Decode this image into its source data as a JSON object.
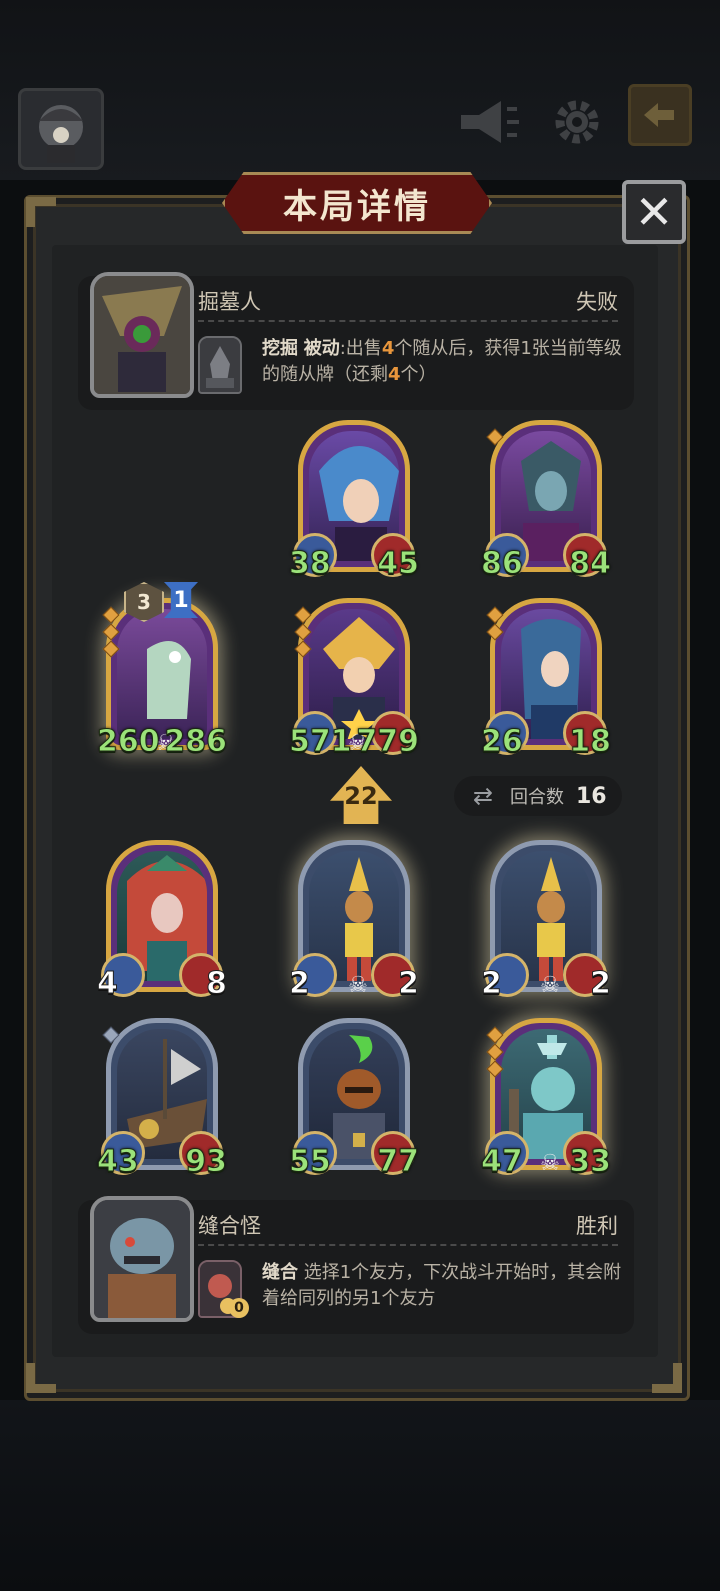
{
  "header": {
    "avatar_icon": "player-avatar-icon",
    "announcement_icon": "megaphone-icon",
    "settings_icon": "gear-icon",
    "exit_icon": "exit-door-icon"
  },
  "panel": {
    "title": "本局详情",
    "close_icon": "close-icon",
    "close_glyph": "✕"
  },
  "opponent": {
    "name": "掘墓人",
    "result": "失败",
    "ability_name": "挖掘",
    "ability_type": "被动",
    "ability_text_1": ":出售",
    "ability_num_1": "4",
    "ability_text_2": "个随从后，获得1张当前等级的随从牌（还剩",
    "ability_num_2": "4",
    "ability_text_3": "个）"
  },
  "opponent_board": {
    "minions": [
      {
        "attack": "38",
        "health": "45",
        "frame": "gold",
        "art_color": "#5a3f95",
        "pips": 0
      },
      {
        "attack": "86",
        "health": "84",
        "frame": "gold",
        "art_color": "#6a3a8a",
        "pips": 1
      },
      {
        "attack": "260",
        "health": "286",
        "frame": "gold",
        "art_color": "#6b3b86",
        "pips": 3,
        "tier": "3",
        "level": "1",
        "deathrattle": true,
        "glow": true
      },
      {
        "attack": "571",
        "health": "779",
        "frame": "gold",
        "art_color": "#55357a",
        "pips": 3,
        "deathrattle": true
      },
      {
        "attack": "26",
        "health": "18",
        "frame": "gold",
        "art_color": "#5a3c88",
        "pips": 2
      }
    ]
  },
  "mid": {
    "tavern_tier": "22",
    "turn_label": "回合数",
    "turn_number": "16",
    "turn_icon": "swap-arrows-icon"
  },
  "player_board": {
    "minions": [
      {
        "attack": "4",
        "health": "8",
        "frame": "gold",
        "art_color": "#2d5a58",
        "pips": 0,
        "white_stats": true
      },
      {
        "attack": "2",
        "health": "2",
        "frame": "silver",
        "art_color": "#3c4f6e",
        "pips": 0,
        "white_stats": true,
        "deathrattle": true,
        "glow": true
      },
      {
        "attack": "2",
        "health": "2",
        "frame": "silver",
        "art_color": "#3c4f6e",
        "pips": 0,
        "white_stats": true,
        "deathrattle": true,
        "glow": true
      },
      {
        "attack": "43",
        "health": "93",
        "frame": "silver",
        "art_color": "#3a4660",
        "pips": 1
      },
      {
        "attack": "55",
        "health": "77",
        "frame": "silver",
        "art_color": "#34405a",
        "pips": 0
      },
      {
        "attack": "47",
        "health": "33",
        "frame": "gold",
        "art_color": "#3d6a74",
        "pips": 3,
        "deathrattle": true,
        "glow": true
      }
    ]
  },
  "player": {
    "name": "缝合怪",
    "result": "胜利",
    "ability_name": "缝合",
    "ability_text": " 选择1个友方，下次战斗开始时，其会附着给同列的另1个友方",
    "ability_counter": "0"
  }
}
